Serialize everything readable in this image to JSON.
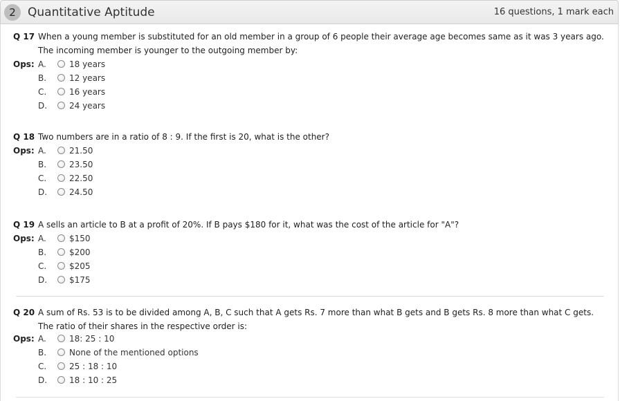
{
  "section": {
    "number": "2",
    "title": "Quantitative Aptitude",
    "meta": "16 questions, 1 mark each"
  },
  "ops_label": "Ops:",
  "questions": [
    {
      "label": "Q 17",
      "text": "When a young member is substituted for an old member in a group of 6 people their average age becomes same as it was 3 years ago. The incoming member is younger to the outgoing member by:",
      "options": [
        {
          "letter": "A.",
          "text": "18 years"
        },
        {
          "letter": "B.",
          "text": "12 years"
        },
        {
          "letter": "C.",
          "text": "16 years"
        },
        {
          "letter": "D.",
          "text": "24 years"
        }
      ]
    },
    {
      "label": "Q 18",
      "text": "Two numbers are in a ratio of 8 : 9. If the first is 20, what is the other?",
      "options": [
        {
          "letter": "A.",
          "text": "21.50"
        },
        {
          "letter": "B.",
          "text": "23.50"
        },
        {
          "letter": "C.",
          "text": "22.50"
        },
        {
          "letter": "D.",
          "text": "24.50"
        }
      ]
    },
    {
      "label": "Q 19",
      "text": "A sells an article to B at a profit of 20%. If B pays $180 for it, what was the cost of the article for \"A\"?",
      "options": [
        {
          "letter": "A.",
          "text": "$150"
        },
        {
          "letter": "B.",
          "text": "$200"
        },
        {
          "letter": "C.",
          "text": "$205"
        },
        {
          "letter": "D.",
          "text": "$175"
        }
      ]
    },
    {
      "label": "Q 20",
      "text": "A sum of Rs. 53 is to be divided among A, B, C such that A gets Rs. 7 more than what B gets and B gets Rs. 8 more than what C gets. The ratio of their shares in the respective order is:",
      "options": [
        {
          "letter": "A.",
          "text": "18: 25 : 10"
        },
        {
          "letter": "B.",
          "text": "None of the mentioned options"
        },
        {
          "letter": "C.",
          "text": "25 : 18 : 10"
        },
        {
          "letter": "D.",
          "text": "18 : 10 : 25"
        }
      ]
    }
  ]
}
